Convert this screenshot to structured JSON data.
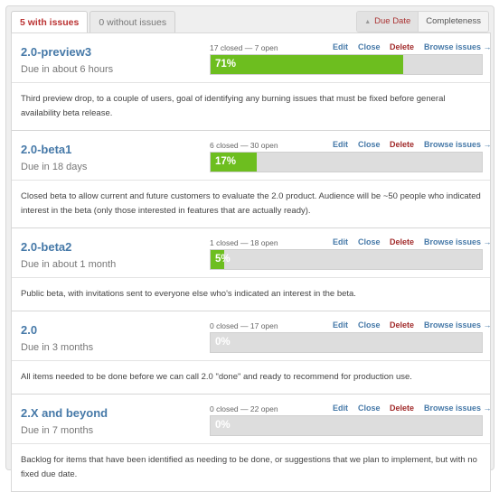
{
  "tabs": [
    {
      "label": "5 with issues",
      "active": true
    },
    {
      "label": "0 without issues",
      "active": false
    }
  ],
  "sort": {
    "due_date_label": "Due Date",
    "completeness_label": "Completeness",
    "active": "due_date"
  },
  "actions": {
    "edit": "Edit",
    "close": "Close",
    "delete": "Delete",
    "browse": "Browse issues →"
  },
  "colors": {
    "progress_fill": "#6dbe1f",
    "progress_track": "#dddddd",
    "link": "#4679a8",
    "delete": "#a12a2a"
  },
  "milestones": [
    {
      "title": "2.0-preview3",
      "due": "Due in about 6 hours",
      "counts": "17 closed — 7 open",
      "progress_label": "71%",
      "progress": 0.71,
      "description": "Third preview drop, to a couple of users, goal of identifying any burning issues that must be fixed before general availability beta release."
    },
    {
      "title": "2.0-beta1",
      "due": "Due in 18 days",
      "counts": "6 closed — 30 open",
      "progress_label": "17%",
      "progress": 0.17,
      "description": "Closed beta to allow current and future customers to evaluate the 2.0 product. Audience will be ~50 people who indicated interest in the beta (only those interested in features that are actually ready)."
    },
    {
      "title": "2.0-beta2",
      "due": "Due in about 1 month",
      "counts": "1 closed — 18 open",
      "progress_label": "5%",
      "progress": 0.05,
      "description": "Public beta, with invitations sent to everyone else who's indicated an interest in the beta."
    },
    {
      "title": "2.0",
      "due": "Due in 3 months",
      "counts": "0 closed — 17 open",
      "progress_label": "0%",
      "progress": 0,
      "description": "All items needed to be done before we can call 2.0 \"done\" and ready to recommend for production use."
    },
    {
      "title": "2.X and beyond",
      "due": "Due in 7 months",
      "counts": "0 closed — 22 open",
      "progress_label": "0%",
      "progress": 0,
      "description": "Backlog for items that have been identified as needing to be done, or suggestions that we plan to implement, but with no fixed due date."
    }
  ]
}
